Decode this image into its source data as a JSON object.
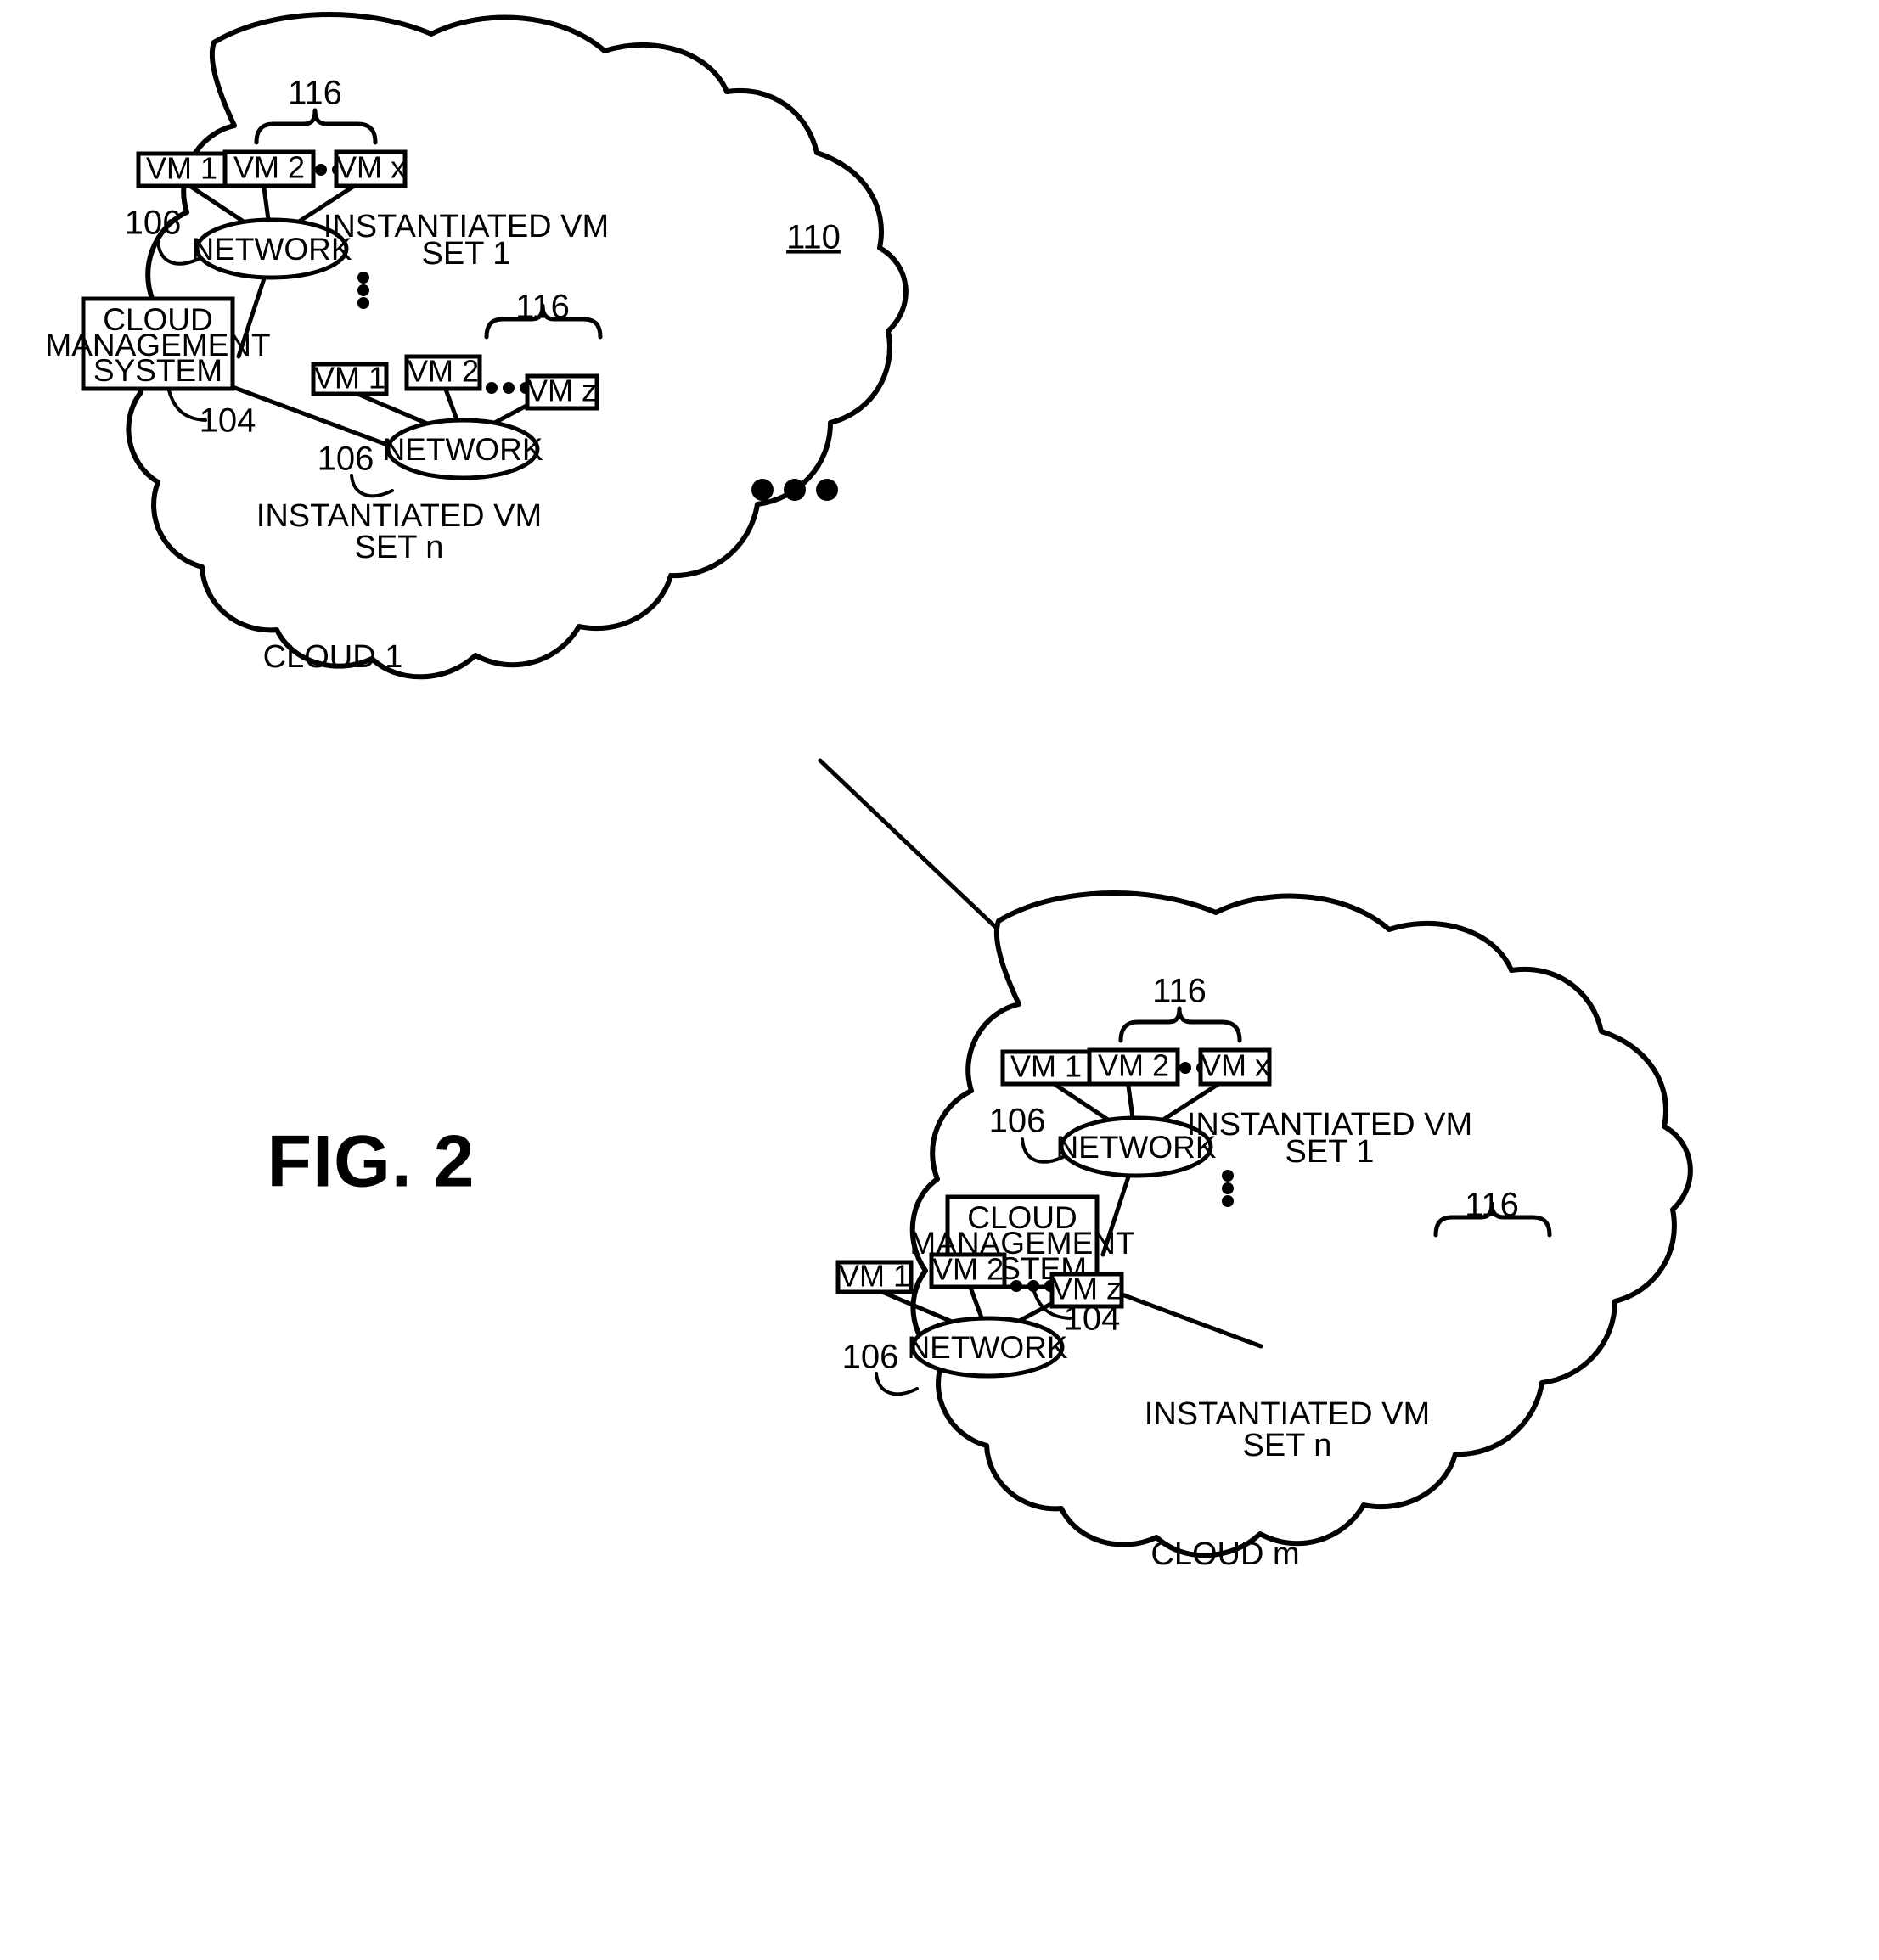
{
  "figure": {
    "label": "FIG. 2",
    "overall_ref": "110"
  },
  "refs": {
    "cloud_management_system": "104",
    "network": "106",
    "vm_set_bracket": "116"
  },
  "labels": {
    "cloud_management_system": [
      "CLOUD",
      "MANAGEMENT",
      "SYSTEM"
    ],
    "network": "NETWORK",
    "instantiated_vm_set_1": [
      "INSTANTIATED VM",
      "SET 1"
    ],
    "instantiated_vm_set_n": [
      "INSTANTIATED VM",
      "SET n"
    ]
  },
  "clouds": [
    {
      "name": "CLOUD 1",
      "cms_ref": "104",
      "vm_sets": [
        {
          "set_label_line1": "INSTANTIATED VM",
          "set_label_line2": "SET 1",
          "bracket_ref": "116",
          "network_label": "NETWORK",
          "network_ref": "106",
          "vms": [
            "VM 1",
            "VM 2",
            "VM x"
          ],
          "ellipsis_between": "•••"
        },
        {
          "set_label_line1": "INSTANTIATED VM",
          "set_label_line2": "SET n",
          "bracket_ref": "116",
          "network_label": "NETWORK",
          "network_ref": "106",
          "vms": [
            "VM 1",
            "VM 2",
            "VM z"
          ],
          "ellipsis_between": "•••"
        }
      ]
    },
    {
      "name": "CLOUD m",
      "cms_ref": "104",
      "vm_sets": [
        {
          "set_label_line1": "INSTANTIATED VM",
          "set_label_line2": "SET 1",
          "bracket_ref": "116",
          "network_label": "NETWORK",
          "network_ref": "106",
          "vms": [
            "VM 1",
            "VM 2",
            "VM x"
          ],
          "ellipsis_between": "•••"
        },
        {
          "set_label_line1": "INSTANTIATED VM",
          "set_label_line2": "SET n",
          "bracket_ref": "116",
          "network_label": "NETWORK",
          "network_ref": "106",
          "vms": [
            "VM 1",
            "VM 2",
            "VM z"
          ],
          "ellipsis_between": "•••"
        }
      ]
    }
  ],
  "between_clouds_ellipsis": "• • •",
  "colors": {
    "ink": "#000000",
    "paper": "#ffffff"
  }
}
